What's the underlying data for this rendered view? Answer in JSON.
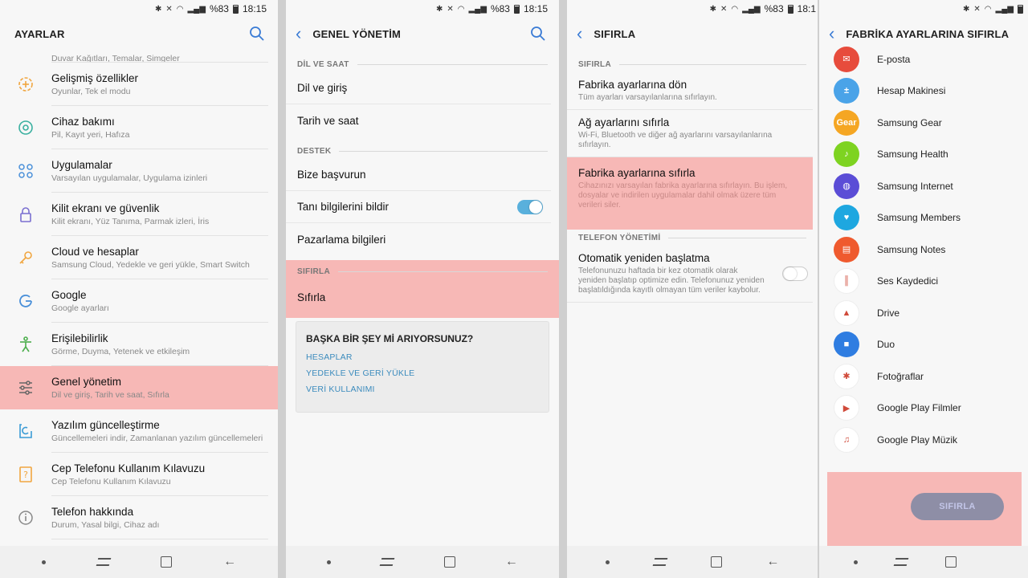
{
  "statusbar": {
    "battery": "%83",
    "time": "18:15",
    "time_cut": "18:1"
  },
  "p1": {
    "title": "AYARLAR",
    "first_sub": "Duvar Kağıtları, Temalar, Simgeler",
    "items": [
      {
        "title": "Gelişmiş özellikler",
        "sub": "Oyunlar, Tek el modu"
      },
      {
        "title": "Cihaz bakımı",
        "sub": "Pil, Kayıt yeri, Hafıza"
      },
      {
        "title": "Uygulamalar",
        "sub": "Varsayılan uygulamalar, Uygulama izinleri"
      },
      {
        "title": "Kilit ekranı ve güvenlik",
        "sub": "Kilit ekranı, Yüz Tanıma, Parmak izleri, İris"
      },
      {
        "title": "Cloud ve hesaplar",
        "sub": "Samsung Cloud, Yedekle ve geri yükle, Smart Switch"
      },
      {
        "title": "Google",
        "sub": "Google ayarları"
      },
      {
        "title": "Erişilebilirlik",
        "sub": "Görme, Duyma, Yetenek ve etkileşim"
      },
      {
        "title": "Genel yönetim",
        "sub": "Dil ve giriş, Tarih ve saat, Sıfırla"
      },
      {
        "title": "Yazılım güncelleştirme",
        "sub": "Güncellemeleri indir, Zamanlanan yazılım güncellemeleri"
      },
      {
        "title": "Cep Telefonu Kullanım Kılavuzu",
        "sub": "Cep Telefonu Kullanım Kılavuzu"
      },
      {
        "title": "Telefon hakkında",
        "sub": "Durum, Yasal bilgi, Cihaz adı"
      }
    ]
  },
  "p2": {
    "title": "GENEL YÖNETİM",
    "sec1": "DİL VE SAAT",
    "dil": "Dil ve giriş",
    "tarih": "Tarih ve saat",
    "sec2": "DESTEK",
    "bize": "Bize başvurun",
    "tani": "Tanı bilgilerini bildir",
    "pazarlama": "Pazarlama bilgileri",
    "sec3": "SIFIRLA",
    "sifirla": "Sıfırla",
    "card_title": "BAŞKA BİR ŞEY Mİ ARIYORSUNUZ?",
    "links": [
      "HESAPLAR",
      "YEDEKLE VE GERİ YÜKLE",
      "VERİ KULLANIMI"
    ]
  },
  "p3": {
    "title": "SIFIRLA",
    "sec1": "SIFIRLA",
    "r1_t": "Fabrika ayarlarına dön",
    "r1_s": "Tüm ayarları varsayılanlarına sıfırlayın.",
    "r2_t": "Ağ ayarlarını sıfırla",
    "r2_s": "Wi-Fi, Bluetooth ve diğer ağ ayarlarını varsayılanlarına sıfırlayın.",
    "r3_t": "Fabrika ayarlarına sıfırla",
    "r3_s": "Cihazınızı varsayılan fabrika ayarlarına sıfırlayın. Bu işlem, dosyalar ve indirilen uygulamalar dahil olmak üzere tüm verileri siler.",
    "sec2": "TELEFON YÖNETİMİ",
    "r4_t": "Otomatik yeniden başlatma",
    "r4_s": "Telefonunuzu haftada bir kez otomatik olarak yeniden başlatıp optimize edin. Telefonunuz yeniden başlatıldığında kayıtlı olmayan tüm veriler kaybolur."
  },
  "p4": {
    "title": "FABRİKA AYARLARINA SIFIRLA",
    "apps": [
      {
        "name": "E-posta",
        "color": "#e74c3c",
        "glyph": "✉"
      },
      {
        "name": "Hesap Makinesi",
        "color": "#4aa3e8",
        "glyph": "±"
      },
      {
        "name": "Samsung Gear",
        "color": "#f5a623",
        "glyph": "Gear"
      },
      {
        "name": "Samsung Health",
        "color": "#7ed321",
        "glyph": "♪"
      },
      {
        "name": "Samsung Internet",
        "color": "#5b4dd6",
        "glyph": "◍"
      },
      {
        "name": "Samsung Members",
        "color": "#1ea7e0",
        "glyph": "♥"
      },
      {
        "name": "Samsung Notes",
        "color": "#ef5a2e",
        "glyph": "▤"
      },
      {
        "name": "Ses Kaydedici",
        "color": "#ffffff",
        "glyph": "║"
      },
      {
        "name": "Drive",
        "color": "#ffffff",
        "glyph": "▲"
      },
      {
        "name": "Duo",
        "color": "#2f7de1",
        "glyph": "■"
      },
      {
        "name": "Fotoğraflar",
        "color": "#ffffff",
        "glyph": "✱"
      },
      {
        "name": "Google Play Filmler",
        "color": "#ffffff",
        "glyph": "▶"
      },
      {
        "name": "Google Play Müzik",
        "color": "#ffffff",
        "glyph": "♫"
      }
    ],
    "button": "SIFIRLA"
  },
  "colors": {
    "highlight": "#f7b8b6",
    "accent": "#3a7bd5",
    "toggle": "#59b0dc"
  }
}
